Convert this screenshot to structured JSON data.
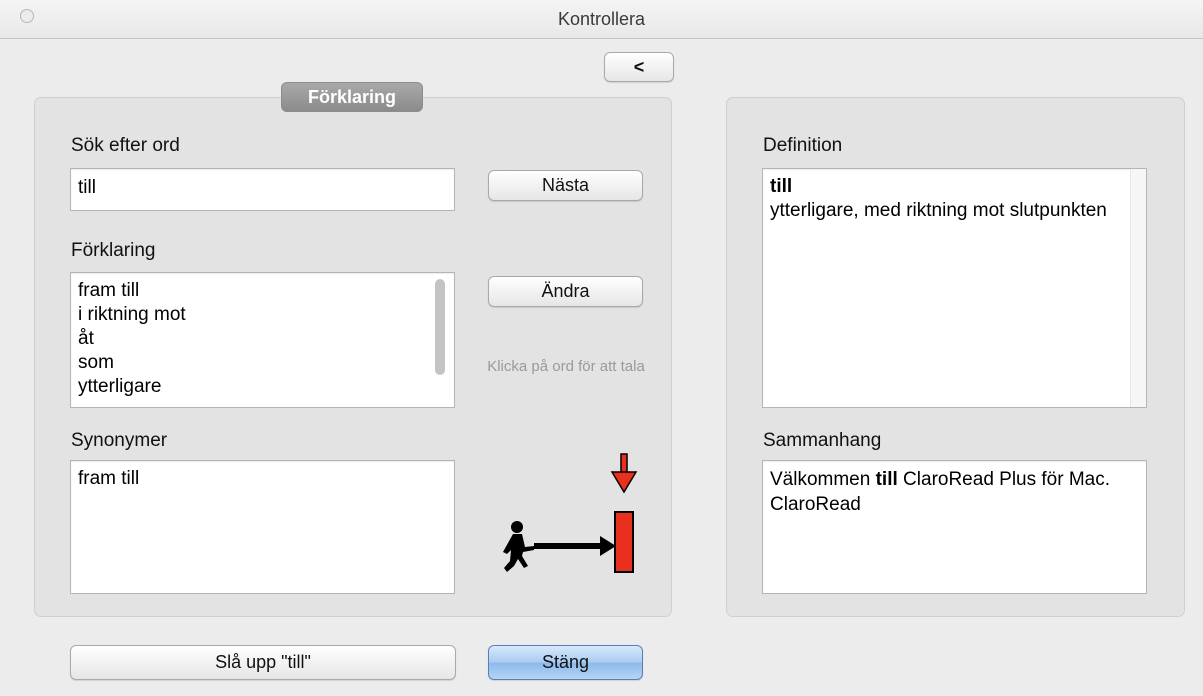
{
  "window": {
    "title": "Kontrollera"
  },
  "toolbar": {
    "back_label": "<"
  },
  "left_panel": {
    "tab_label": "Förklaring",
    "search": {
      "label": "Sök efter ord",
      "value": "till"
    },
    "next_button": "Nästa",
    "explanation": {
      "label": "Förklaring",
      "items": [
        "fram till",
        "i riktning mot",
        "åt",
        "som",
        "ytterligare"
      ]
    },
    "change_button": "Ändra",
    "hint": "Klicka på ord för att tala",
    "synonyms": {
      "label": "Synonymer",
      "items": [
        "fram till"
      ]
    }
  },
  "right_panel": {
    "definition": {
      "label": "Definition",
      "word": "till",
      "text": "ytterligare, med riktning mot slutpunkten"
    },
    "context": {
      "label": "Sammanhang",
      "before": "Välkommen ",
      "highlight": "till",
      "after": " ClaroRead Plus för Mac. ClaroRead"
    }
  },
  "footer": {
    "lookup_button": "Slå upp \"till\"",
    "close_button": "Stäng"
  },
  "colors": {
    "arrow_red": "#e8301c",
    "accent_blue": "#9cc3ef"
  },
  "icons": {
    "illustration": "person-walking-to-target-icon"
  }
}
